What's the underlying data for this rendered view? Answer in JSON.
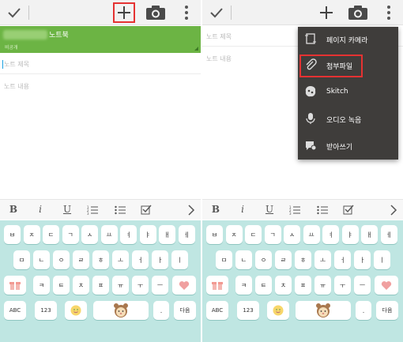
{
  "colors": {
    "accent": "#6cb444",
    "highlight": "#e53232",
    "keyboard_bg": "#bfe6e2",
    "menu_bg": "#3f3d3b"
  },
  "action_bar": {
    "icons": [
      "check-icon",
      "plus-icon",
      "camera-icon",
      "more-vert-icon"
    ]
  },
  "left": {
    "notebook": {
      "name": "노트북",
      "subtitle": "비공개"
    },
    "title_placeholder": "노트 제목",
    "content_placeholder": "노트 내용"
  },
  "right": {
    "title_placeholder": "노트 제목",
    "content_placeholder": "노트 내용",
    "menu": [
      {
        "label": "페이지 카메라",
        "icon": "page-camera-icon"
      },
      {
        "label": "첨부파일",
        "icon": "paperclip-icon"
      },
      {
        "label": "Skitch",
        "icon": "skitch-icon"
      },
      {
        "label": "오디오 녹음",
        "icon": "microphone-icon"
      },
      {
        "label": "받아쓰기",
        "icon": "dictation-icon"
      }
    ]
  },
  "format_bar": {
    "bold": "B",
    "italic": "i",
    "underline": "U"
  },
  "keyboard": {
    "row1": [
      "ㅂ",
      "ㅈ",
      "ㄷ",
      "ㄱ",
      "ㅅ",
      "ㅛ",
      "ㅕ",
      "ㅑ",
      "ㅐ",
      "ㅔ"
    ],
    "row2": [
      "ㅁ",
      "ㄴ",
      "ㅇ",
      "ㄹ",
      "ㅎ",
      "ㅗ",
      "ㅓ",
      "ㅏ",
      "ㅣ"
    ],
    "row3": [
      "ㅋ",
      "ㅌ",
      "ㅊ",
      "ㅍ",
      "ㅠ",
      "ㅜ",
      "ㅡ"
    ],
    "abc": "ABC",
    "num": "123",
    "period": ".",
    "next": "다음"
  }
}
